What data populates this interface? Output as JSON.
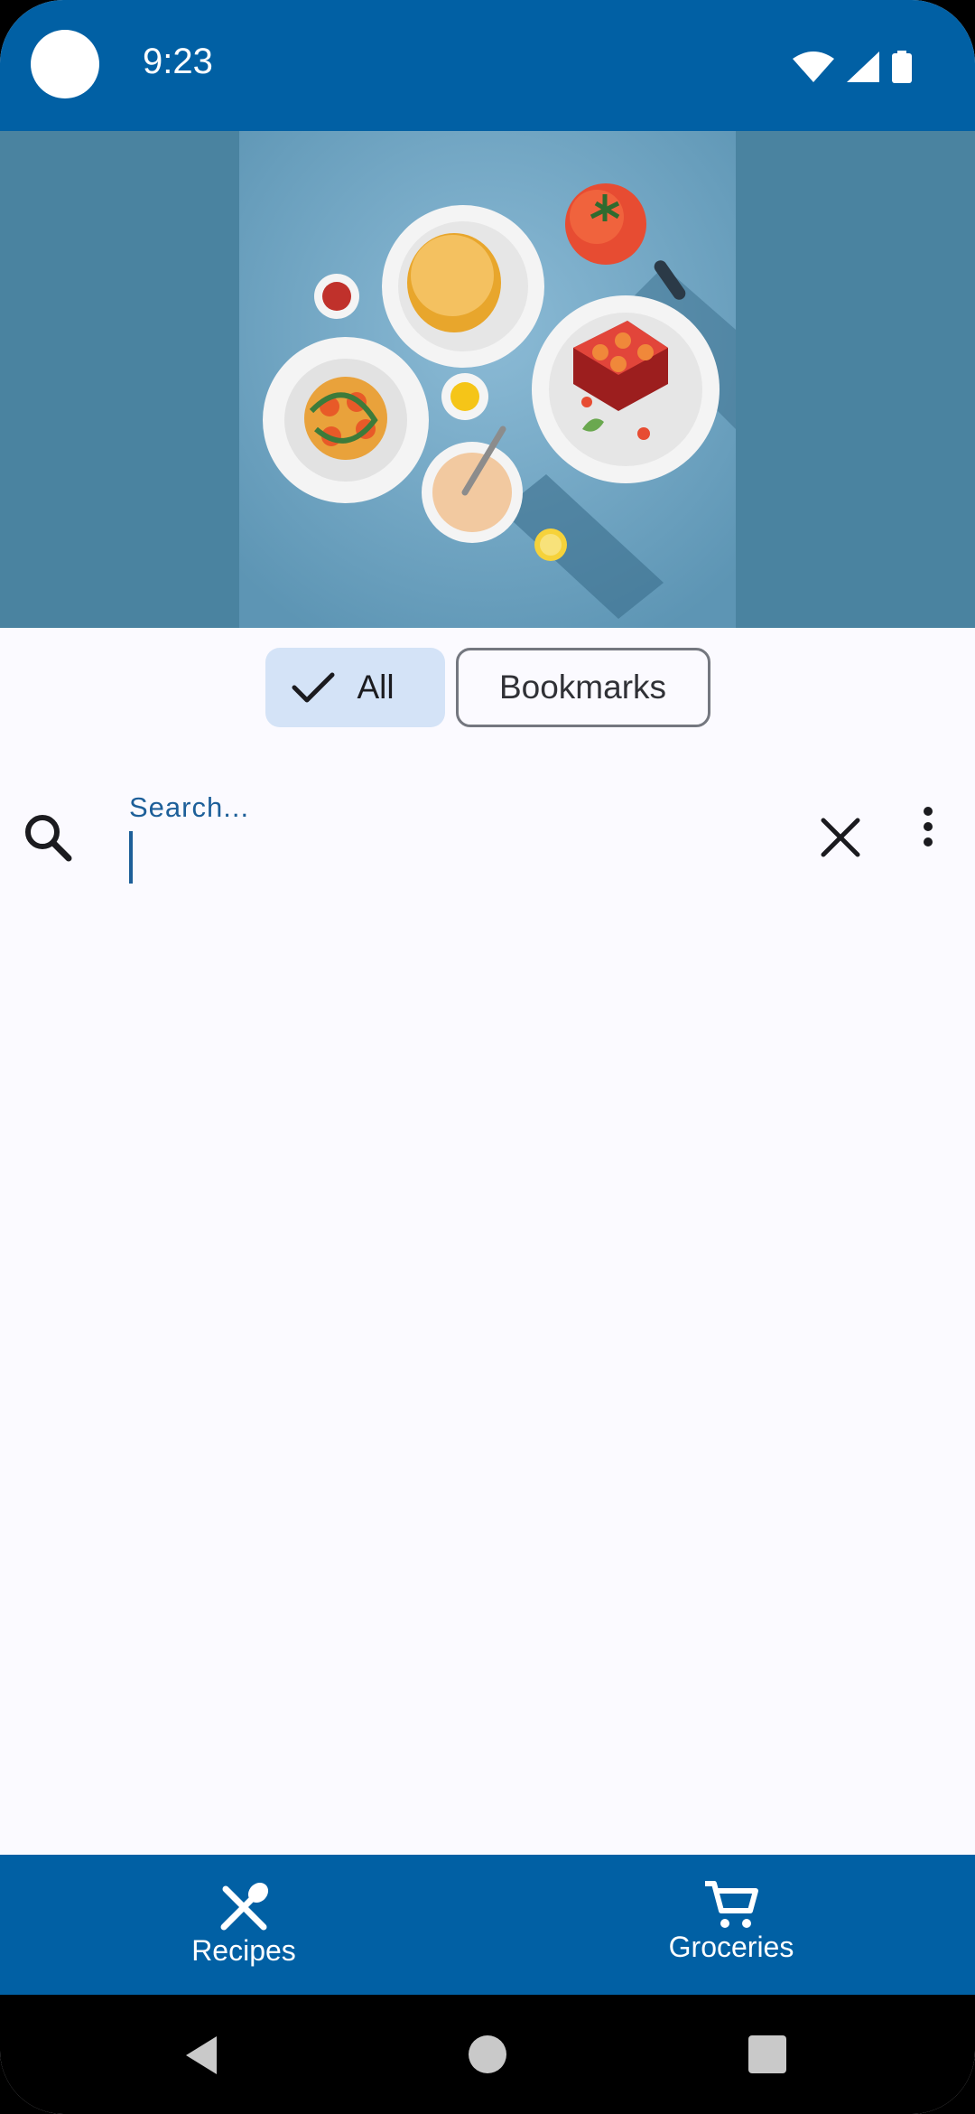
{
  "status_bar": {
    "time": "9:23",
    "icons": [
      "wifi-icon",
      "signal-icon",
      "battery-icon"
    ],
    "background": "#0160a4"
  },
  "hero": {
    "image": "food-illustration",
    "background": "#4a83a0"
  },
  "filter_chips": [
    {
      "label": "All",
      "selected": true,
      "icon": "check-icon"
    },
    {
      "label": "Bookmarks",
      "selected": false
    }
  ],
  "search": {
    "label": "Search...",
    "value": "",
    "icons": [
      "search-icon",
      "close-icon",
      "more-vert-icon"
    ]
  },
  "bottom_nav": {
    "items": [
      {
        "label": "Recipes",
        "icon": "restaurant-icon"
      },
      {
        "label": "Groceries",
        "icon": "cart-icon"
      }
    ],
    "background": "#0160a4"
  },
  "system_nav": {
    "buttons": [
      "back-button",
      "home-button",
      "recents-button"
    ]
  },
  "colors": {
    "primary": "#0160a4",
    "chip_selected": "#d4e3f7",
    "surface": "#fbfaff",
    "accent_text": "#1d5f99"
  }
}
